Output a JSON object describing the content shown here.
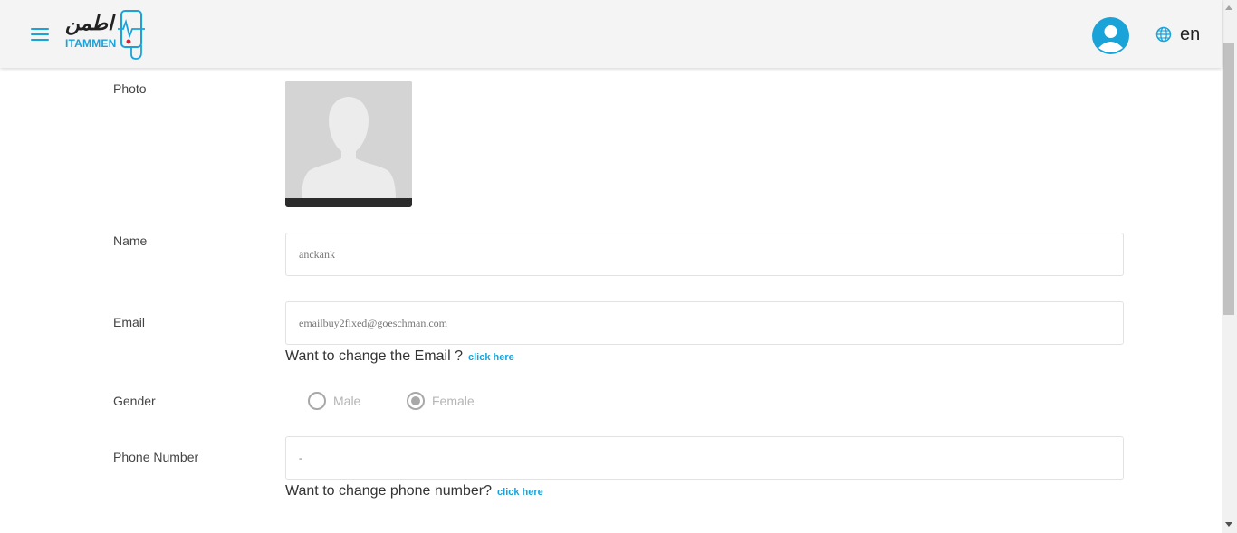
{
  "header": {
    "logo_arabic": "اطمن",
    "logo_text": "ITAMMEN",
    "language": "en"
  },
  "form": {
    "photo_label": "Photo",
    "name_label": "Name",
    "name_value": "anckank",
    "email_label": "Email",
    "email_value": "emailbuy2fixed@goeschman.com",
    "email_help": "Want to change the Email ?",
    "email_link": "click here",
    "gender_label": "Gender",
    "gender_options": [
      "Male",
      "Female"
    ],
    "gender_selected": "Female",
    "phone_label": "Phone Number",
    "phone_value": "-",
    "phone_help": "Want to change phone number?",
    "phone_link": "click here"
  },
  "colors": {
    "accent": "#1aa3d9",
    "header_bg": "#f4f4f4"
  },
  "icons": {
    "menu": "hamburger-menu-icon",
    "avatar": "user-avatar-icon",
    "language": "globe-icon",
    "photo": "person-silhouette-placeholder"
  }
}
